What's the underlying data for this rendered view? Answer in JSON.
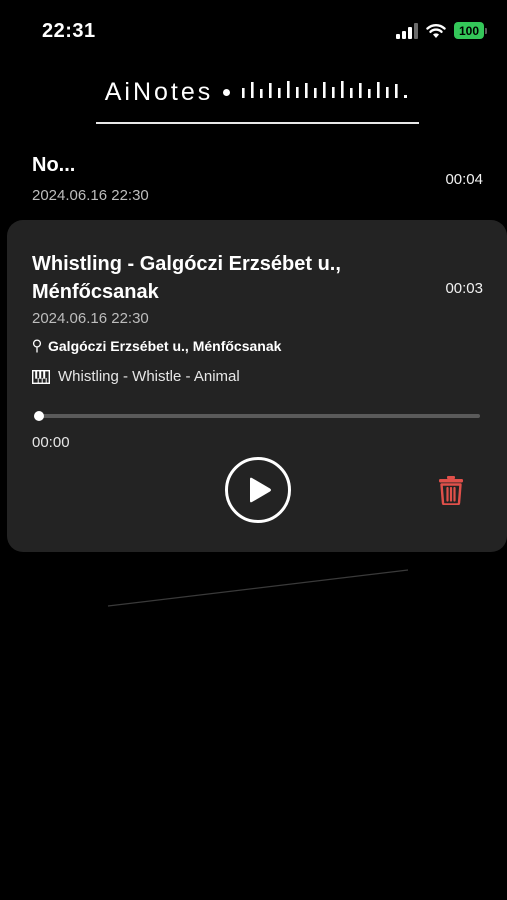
{
  "status_bar": {
    "time": "22:31",
    "battery_level": "100",
    "icons": [
      "signal-icon",
      "wifi-icon",
      "battery-icon"
    ]
  },
  "header": {
    "title": "AiNotes",
    "icons": [
      "dot-separator-icon",
      "waveform-icon"
    ]
  },
  "notes": [
    {
      "title": "No...",
      "date": "2024.06.16 22:30",
      "duration": "00:04"
    },
    {
      "title": "Whistling - Galgóczi Erzsébet u., Ménfőcsanak",
      "date": "2024.06.16 22:30",
      "duration": "00:03",
      "location": "Galgóczi Erzsébet u., Ménfőcsanak",
      "tags": "Whistling - Whistle - Animal",
      "elapsed": "00:00",
      "progress": 0.0,
      "icons": [
        "pin-icon",
        "piano-icon",
        "play-icon",
        "trash-icon"
      ]
    }
  ],
  "colors": {
    "background": "#000000",
    "card": "#232323",
    "battery": "#34c759",
    "delete": "#e0504a",
    "track": "#5a5a5a"
  }
}
